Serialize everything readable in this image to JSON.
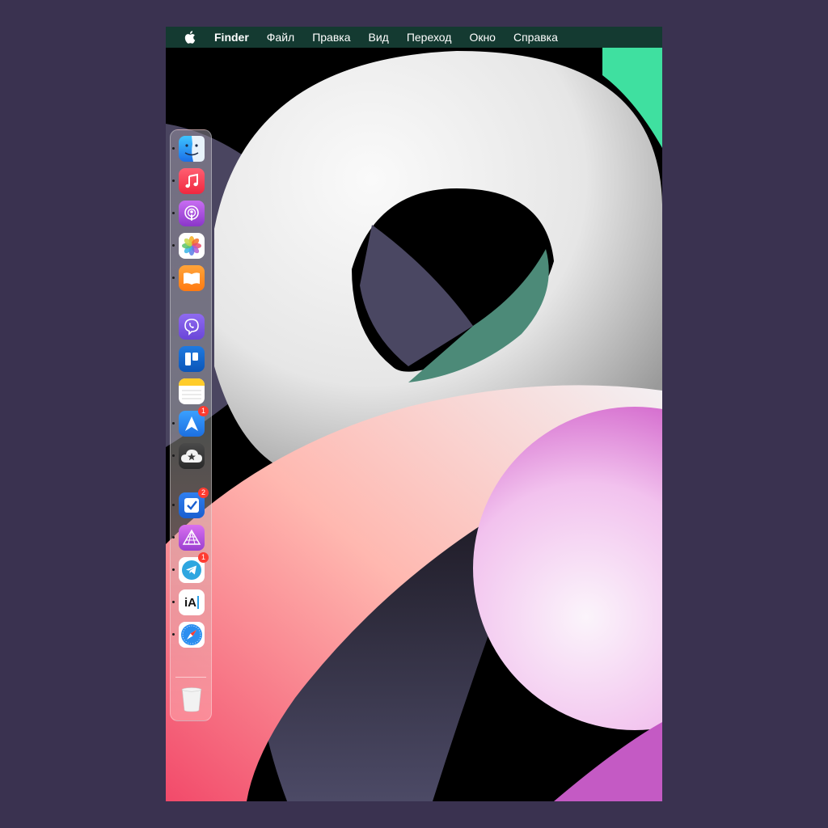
{
  "menubar": {
    "apple_icon": "apple-logo-icon",
    "app_name": "Finder",
    "items": [
      "Файл",
      "Правка",
      "Вид",
      "Переход",
      "Окно",
      "Справка"
    ]
  },
  "dock": {
    "apps": [
      {
        "icon": "finder-icon",
        "running": true
      },
      {
        "icon": "music-icon",
        "running": true
      },
      {
        "icon": "podcasts-icon",
        "running": true
      },
      {
        "icon": "photos-icon",
        "running": true
      },
      {
        "icon": "books-icon",
        "running": true
      },
      {
        "icon": "viber-icon",
        "running": false
      },
      {
        "icon": "trello-icon",
        "running": false
      },
      {
        "icon": "notes-icon",
        "running": true
      },
      {
        "icon": "spark-mail-icon",
        "running": true,
        "badge": "1"
      },
      {
        "icon": "cloudmounter-icon",
        "running": true
      },
      {
        "icon": "things-icon",
        "running": true,
        "badge": "2"
      },
      {
        "icon": "affinity-photo-icon",
        "running": true
      },
      {
        "icon": "telegram-icon",
        "running": true,
        "badge": "1"
      },
      {
        "icon": "ia-writer-icon",
        "running": true
      },
      {
        "icon": "safari-icon",
        "running": true
      }
    ],
    "trash_icon": "trash-icon",
    "ia_writer_text": "iA"
  },
  "colors": {
    "page_background": "#3a3250",
    "menubar_background": "#143a31",
    "badge": "#ff3b30"
  }
}
